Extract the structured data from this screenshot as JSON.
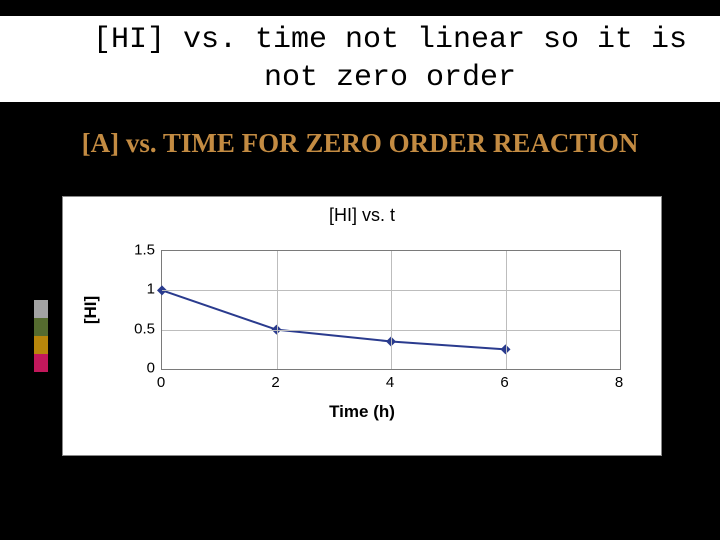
{
  "title_line1": "[HI] vs. time not linear so it is",
  "title_line2": "not zero order",
  "subtitle": "[A] vs. TIME FOR ZERO ORDER REACTION",
  "chart_data": {
    "type": "line",
    "title": "[HI] vs. t",
    "xlabel": "Time (h)",
    "ylabel": "[HI]",
    "x_ticks": [
      0,
      2,
      4,
      6,
      8
    ],
    "y_ticks": [
      0,
      0.5,
      1,
      1.5
    ],
    "xlim": [
      0,
      8
    ],
    "ylim": [
      0,
      1.5
    ],
    "series": [
      {
        "name": "[HI]",
        "color": "#2a3b8e",
        "x": [
          0,
          2,
          4,
          6
        ],
        "y": [
          1.0,
          0.5,
          0.35,
          0.25
        ]
      }
    ]
  }
}
